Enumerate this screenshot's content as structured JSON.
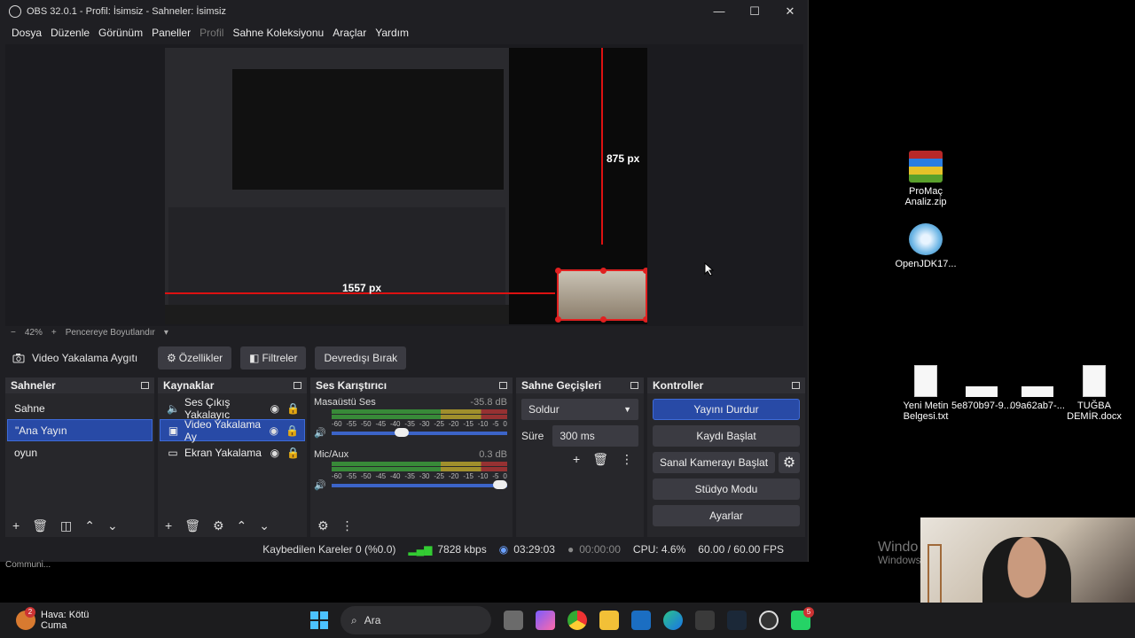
{
  "window": {
    "title": "OBS 32.0.1 - Profil: İsimsiz - Sahneler: İsimsiz",
    "minimize": "—",
    "maximize": "☐",
    "close": "✕"
  },
  "menu": [
    "Dosya",
    "Düzenle",
    "Görünüm",
    "Paneller",
    "Profil",
    "Sahne Koleksiyonu",
    "Araçlar",
    "Yardım"
  ],
  "preview": {
    "label_vertical": "875 px",
    "label_horizontal": "1557 px"
  },
  "zoom": {
    "minus": "−",
    "value": "42%",
    "plus": "+",
    "fit": "Pencereye Boyutlandır",
    "dropdown": "▾"
  },
  "source_toolbar": {
    "source_name": "Video Yakalama Aygıtı",
    "properties": "Özellikler",
    "filters": "Filtreler",
    "deactivate": "Devredışı Bırak"
  },
  "scenes": {
    "title": "Sahneler",
    "items": [
      "Sahne",
      "\"Ana Yayın",
      "oyun"
    ],
    "selected_index": 1
  },
  "sources": {
    "title": "Kaynaklar",
    "items": [
      {
        "label": "Ses Çıkış Yakalayıc",
        "icon": "speaker-icon"
      },
      {
        "label": "Video Yakalama Ay",
        "icon": "camera-icon"
      },
      {
        "label": "Ekran Yakalama",
        "icon": "monitor-icon"
      }
    ],
    "selected_index": 1
  },
  "mixer": {
    "title": "Ses Karıştırıcı",
    "channels": [
      {
        "name": "Masaüstü Ses",
        "db": "-35.8 dB",
        "volume": 0.4
      },
      {
        "name": "Mic/Aux",
        "db": "0.3 dB",
        "volume": 1.0
      }
    ],
    "ticks": [
      "-60",
      "-55",
      "-50",
      "-45",
      "-40",
      "-35",
      "-30",
      "-25",
      "-20",
      "-15",
      "-10",
      "-5",
      "0"
    ]
  },
  "transitions": {
    "title": "Sahne Geçişleri",
    "selected": "Soldur",
    "duration_label": "Süre",
    "duration_value": "300 ms"
  },
  "controls": {
    "title": "Kontroller",
    "stop_stream": "Yayını Durdur",
    "start_recording": "Kaydı Başlat",
    "virtual_cam": "Sanal Kamerayı Başlat",
    "studio_mode": "Stüdyo Modu",
    "settings": "Ayarlar"
  },
  "status": {
    "dropped": "Kaybedilen Kareler 0 (%0.0)",
    "bitrate": "7828 kbps",
    "stream_time": "03:29:03",
    "rec_time": "00:00:00",
    "cpu": "CPU: 4.6%",
    "fps": "60.00 / 60.00 FPS"
  },
  "desktop": {
    "icons": [
      {
        "label": "ProMaç Analiz.zip",
        "icon": "zip-archive-icon"
      },
      {
        "label": "OpenJDK17...",
        "icon": "installer-disc-icon"
      },
      {
        "label": "Yeni Metin Belgesi.txt",
        "icon": "text-file-icon"
      },
      {
        "label": "5e870b97-9...",
        "icon": "file-icon"
      },
      {
        "label": "09a62ab7-...",
        "icon": "file-icon"
      },
      {
        "label": "TUĞBA DEMİR.docx",
        "icon": "document-icon"
      }
    ],
    "watermark_line1": "Windo",
    "watermark_line2": "Windows",
    "communi": "Communi..."
  },
  "taskbar": {
    "weather_title": "Hava: Kötü",
    "weather_sub": "Cuma",
    "weather_badge": "2",
    "search_placeholder": "Ara",
    "whatsapp_badge": "5"
  },
  "colors": {
    "obs_bg": "#1f1f23",
    "accent_blue": "#284aa6",
    "guide_red": "#d11111"
  }
}
